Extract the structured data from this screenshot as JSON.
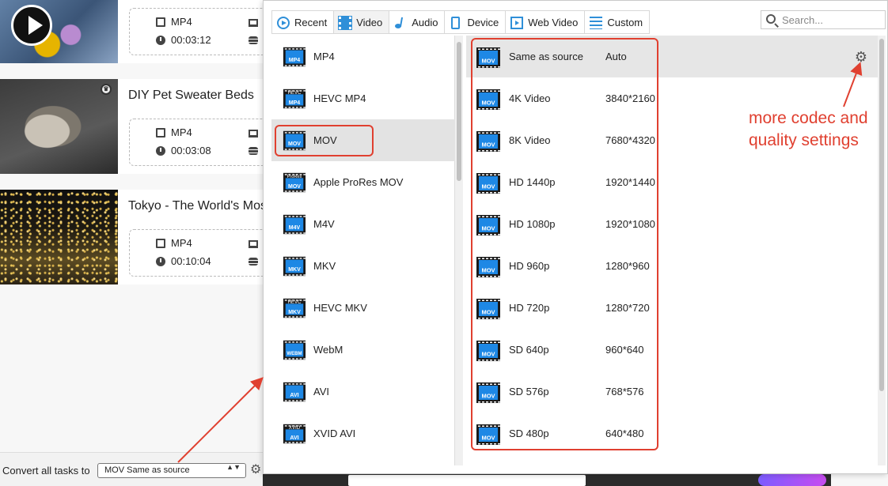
{
  "tasks": [
    {
      "title": "",
      "format": "MP4",
      "duration": "00:03:12"
    },
    {
      "title": "DIY Pet Sweater Beds",
      "format": "MP4",
      "duration": "00:03:08"
    },
    {
      "title": "Tokyo - The World's Most Populous City",
      "format": "MP4",
      "duration": "00:10:04"
    }
  ],
  "bottom_bar": {
    "convert_all_label": "Convert all tasks to",
    "selected_format": "MOV Same as source",
    "select_arrows": "▲▼"
  },
  "tabs": [
    {
      "label": "Recent",
      "icon": "recent-icon"
    },
    {
      "label": "Video",
      "icon": "video-icon",
      "active": true
    },
    {
      "label": "Audio",
      "icon": "audio-note-icon"
    },
    {
      "label": "Device",
      "icon": "device-phone-icon"
    },
    {
      "label": "Web Video",
      "icon": "web-video-icon"
    },
    {
      "label": "Custom",
      "icon": "custom-sliders-icon"
    }
  ],
  "search": {
    "placeholder": "Search..."
  },
  "formats": [
    {
      "name": "MP4",
      "badge": "MP4",
      "badge_top": ""
    },
    {
      "name": "HEVC MP4",
      "badge": "MP4",
      "badge_top": "HEVC"
    },
    {
      "name": "MOV",
      "badge": "MOV",
      "badge_top": "",
      "selected": true
    },
    {
      "name": "Apple ProRes MOV",
      "badge": "MOV",
      "badge_top": "ProRes"
    },
    {
      "name": "M4V",
      "badge": "M4V",
      "badge_top": ""
    },
    {
      "name": "MKV",
      "badge": "MKV",
      "badge_top": ""
    },
    {
      "name": "HEVC MKV",
      "badge": "MKV",
      "badge_top": "HEVC"
    },
    {
      "name": "WebM",
      "badge": "WEBM",
      "badge_top": ""
    },
    {
      "name": "AVI",
      "badge": "AVI",
      "badge_top": ""
    },
    {
      "name": "XVID AVI",
      "badge": "AVI",
      "badge_top": "XVID"
    }
  ],
  "qualities": [
    {
      "name": "Same as source",
      "resolution": "Auto",
      "badge": "MOV",
      "selected": true
    },
    {
      "name": "4K Video",
      "resolution": "3840*2160",
      "badge": "MOV"
    },
    {
      "name": "8K Video",
      "resolution": "7680*4320",
      "badge": "MOV"
    },
    {
      "name": "HD 1440p",
      "resolution": "1920*1440",
      "badge": "MOV"
    },
    {
      "name": "HD 1080p",
      "resolution": "1920*1080",
      "badge": "MOV"
    },
    {
      "name": "HD 960p",
      "resolution": "1280*960",
      "badge": "MOV"
    },
    {
      "name": "HD 720p",
      "resolution": "1280*720",
      "badge": "MOV"
    },
    {
      "name": "SD 640p",
      "resolution": "960*640",
      "badge": "MOV"
    },
    {
      "name": "SD 576p",
      "resolution": "768*576",
      "badge": "MOV"
    },
    {
      "name": "SD 480p",
      "resolution": "640*480",
      "badge": "MOV"
    }
  ],
  "annotation": {
    "text": "more codec and\nquality settings",
    "color": "#e04030"
  },
  "colors": {
    "accent": "#2f8fd8",
    "icon_blue": "#1e88e5",
    "annotation_red": "#e04030"
  }
}
